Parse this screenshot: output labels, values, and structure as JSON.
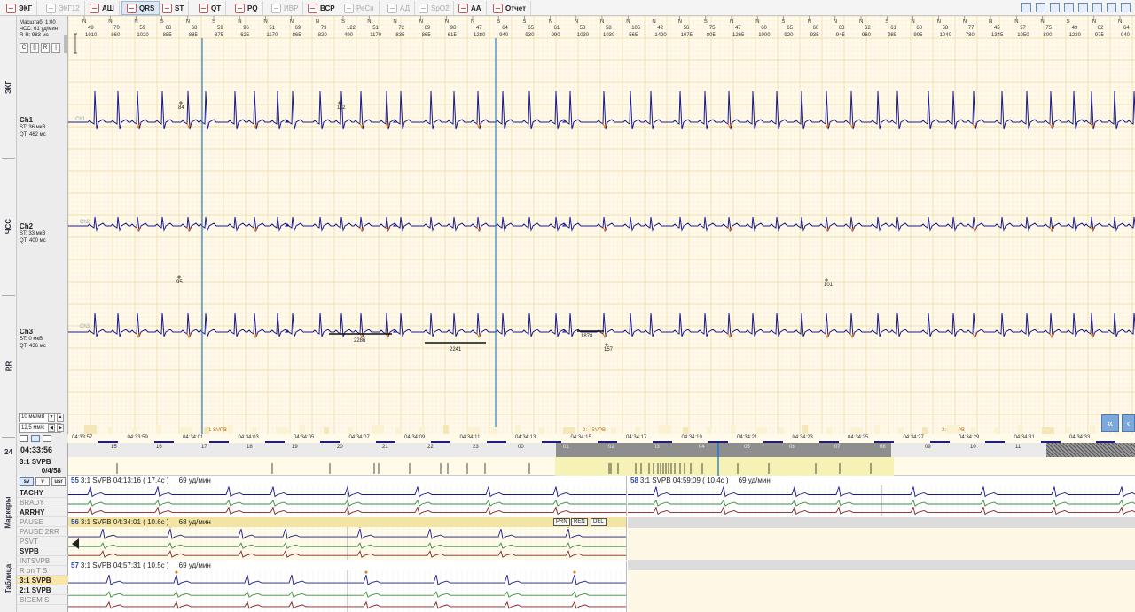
{
  "toolbar": {
    "tabs": [
      {
        "label": "ЭКГ",
        "icon": "ecg-icon",
        "enabled": true,
        "active": false
      },
      {
        "label": "ЭКГ12",
        "icon": "ecg12-icon",
        "enabled": false,
        "active": false
      },
      {
        "label": "АШ",
        "icon": "aberrant-icon",
        "enabled": true,
        "active": false
      },
      {
        "label": "QRS",
        "icon": "qrs-icon",
        "enabled": true,
        "active": true
      },
      {
        "label": "ST",
        "icon": "st-icon",
        "enabled": true,
        "active": false
      },
      {
        "label": "QT",
        "icon": "qt-icon",
        "enabled": true,
        "active": false
      },
      {
        "label": "PQ",
        "icon": "pq-icon",
        "enabled": true,
        "active": false
      },
      {
        "label": "ИВР",
        "icon": "ivr-icon",
        "enabled": false,
        "active": false
      },
      {
        "label": "ВСР",
        "icon": "hrv-icon",
        "enabled": true,
        "active": false
      },
      {
        "label": "РеСп",
        "icon": "respiration-icon",
        "enabled": false,
        "active": false
      },
      {
        "label": "АД",
        "icon": "blood-pressure-icon",
        "enabled": false,
        "active": false
      },
      {
        "label": "SpO2",
        "icon": "spo2-icon",
        "enabled": false,
        "active": false
      },
      {
        "label": "АА",
        "icon": "aa-icon",
        "enabled": true,
        "active": false
      },
      {
        "label": "Отчет",
        "icon": "report-icon",
        "enabled": true,
        "active": false
      }
    ],
    "right_icons": [
      "settings-icon",
      "print-icon",
      "save-icon",
      "layout-1-icon",
      "layout-2-icon",
      "layout-3-icon",
      "layout-4-icon",
      "layout-5-icon"
    ]
  },
  "left_rail": {
    "sections": [
      "ЭКГ",
      "ЧСС",
      "RR",
      "24",
      "Маркеры",
      "Таблица"
    ]
  },
  "info": {
    "scale_label": "Масштаб: 1:00",
    "hr_label": "ЧСС: 61 уд/мин",
    "rr_label": "R-R: 983 мс",
    "speed_label": "10 мм/мВ",
    "time_scale_label": "12,5 мм/с"
  },
  "channels": [
    {
      "name": "Ch1",
      "st": "ST:   36 мкВ",
      "qt": "QT:  462 мс"
    },
    {
      "name": "Ch2",
      "st": "ST:   33 мкВ",
      "qt": "QT:  400 мс"
    },
    {
      "name": "Ch3",
      "st": "ST:    0 мкВ",
      "qt": "QT:  436 мс"
    }
  ],
  "beat_labels": [
    {
      "hr": "49",
      "rr": "1910"
    },
    {
      "hr": "70",
      "rr": "860"
    },
    {
      "hr": "59",
      "rr": "1020"
    },
    {
      "hr": "68",
      "rr": "885"
    },
    {
      "hr": "68",
      "rr": "885"
    },
    {
      "hr": "59",
      "rr": "875"
    },
    {
      "hr": "96",
      "rr": "625"
    },
    {
      "hr": "51",
      "rr": "1170"
    },
    {
      "hr": "69",
      "rr": "865"
    },
    {
      "hr": "73",
      "rr": "820"
    },
    {
      "hr": "122",
      "rr": "490"
    },
    {
      "hr": "51",
      "rr": "1170"
    },
    {
      "hr": "72",
      "rr": "835"
    },
    {
      "hr": "69",
      "rr": "865"
    },
    {
      "hr": "98",
      "rr": "615"
    },
    {
      "hr": "47",
      "rr": "1280"
    },
    {
      "hr": "64",
      "rr": "940"
    },
    {
      "hr": "65",
      "rr": "930"
    },
    {
      "hr": "61",
      "rr": "990"
    },
    {
      "hr": "58",
      "rr": "1030"
    },
    {
      "hr": "58",
      "rr": "1030"
    },
    {
      "hr": "106",
      "rr": "565"
    },
    {
      "hr": "42",
      "rr": "1420"
    },
    {
      "hr": "56",
      "rr": "1075"
    },
    {
      "hr": "75",
      "rr": "805"
    },
    {
      "hr": "47",
      "rr": "1265"
    },
    {
      "hr": "60",
      "rr": "1000"
    },
    {
      "hr": "65",
      "rr": "920"
    },
    {
      "hr": "60",
      "rr": "935"
    },
    {
      "hr": "63",
      "rr": "945"
    },
    {
      "hr": "62",
      "rr": "960"
    },
    {
      "hr": "61",
      "rr": "985"
    },
    {
      "hr": "60",
      "rr": "995"
    },
    {
      "hr": "58",
      "rr": "1040"
    },
    {
      "hr": "77",
      "rr": "780"
    },
    {
      "hr": "45",
      "rr": "1345"
    },
    {
      "hr": "57",
      "rr": "1050"
    },
    {
      "hr": "75",
      "rr": "800"
    },
    {
      "hr": "49",
      "rr": "1220"
    },
    {
      "hr": "62",
      "rr": "975"
    },
    {
      "hr": "64",
      "rr": "940"
    }
  ],
  "beat_type_letter": "N",
  "beat_type_letter_s": "S",
  "annotations": {
    "ch1": [
      {
        "text": "84"
      },
      {
        "text": "112"
      }
    ],
    "ch2": [
      {
        "text": "95"
      },
      {
        "text": "101"
      }
    ],
    "ch3": [
      {
        "text": "2286"
      },
      {
        "text": "2241"
      },
      {
        "text": "1878"
      },
      {
        "text": "157"
      }
    ],
    "events": [
      {
        "text": "3:1 SVPB"
      },
      {
        "text": "2:1 SVPB"
      },
      {
        "text": "2:1 SVPB"
      }
    ]
  },
  "time_labels": [
    "04:33:57",
    "04:33:59",
    "04:34:01",
    "04:34:03",
    "04:34:05",
    "04:34:07",
    "04:34:09",
    "04:34:11",
    "04:34:13",
    "04:34:15",
    "04:34:17",
    "04:34:19",
    "04:34:21",
    "04:34:23",
    "04:34:25",
    "04:34:27",
    "04:34:29",
    "04:34:31",
    "04:34:33"
  ],
  "nav": {
    "current_time": "04:33:56",
    "hour_ticks": [
      "15",
      "16",
      "17",
      "18",
      "19",
      "20",
      "21",
      "22",
      "23",
      "00",
      "01",
      "02",
      "03",
      "04",
      "05",
      "06",
      "07",
      "08",
      "09",
      "10",
      "11"
    ]
  },
  "event_row": {
    "label": "3:1 SVPB",
    "count": "0/4/58"
  },
  "markers": {
    "mode_buttons": [
      "sv",
      "v",
      "usr"
    ],
    "items": [
      {
        "label": "TACHY",
        "style": "bold"
      },
      {
        "label": "BRADY",
        "style": "gray"
      },
      {
        "label": "ARRHY",
        "style": "bold"
      },
      {
        "label": "PAUSE",
        "style": "gray"
      },
      {
        "label": "PAUSE 2RR",
        "style": "gray"
      },
      {
        "label": "PSVT",
        "style": "gray"
      },
      {
        "label": "SVPB",
        "style": "bold"
      },
      {
        "label": "INTSVPB",
        "style": "gray"
      },
      {
        "label": "R on T S",
        "style": "gray"
      },
      {
        "label": "3:1 SVPB",
        "style": "selected"
      },
      {
        "label": "2:1 SVPB",
        "style": "bold"
      },
      {
        "label": "BIGEM S",
        "style": "gray"
      }
    ]
  },
  "strips": [
    {
      "num": "55",
      "title": "3:1 SVPB  04:13:16 ( 17.4с )",
      "hr": "69 уд/мин",
      "selected": false
    },
    {
      "num": "58",
      "title": "3:1 SVPB  04:59:09 ( 10.4с )",
      "hr": "69 уд/мин",
      "selected": false
    },
    {
      "num": "56",
      "title": "3:1 SVPB  04:34:01 ( 10.6с )",
      "hr": "68 уд/мин",
      "selected": true
    },
    {
      "num": "57",
      "title": "3:1 SVPB  04:57:31 ( 10.5с )",
      "hr": "69 уд/мин",
      "selected": false
    }
  ],
  "strip_buttons": [
    "PRN",
    "REN",
    "DEL"
  ],
  "colors": {
    "trace": "#1a1a8c",
    "svpb_mark": "#e07a20",
    "grid_minor": "#f2e4bf",
    "grid_major": "#e8c98a",
    "cursor": "#2d7fc8",
    "selected_bg": "#f4e4a3"
  }
}
